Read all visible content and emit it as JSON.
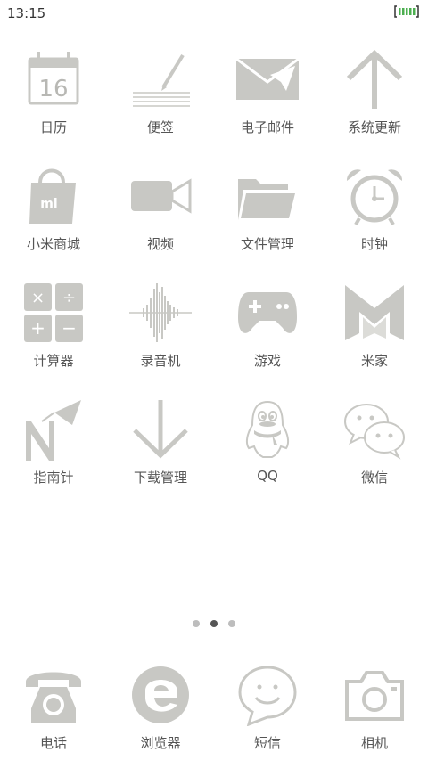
{
  "status": {
    "time": "13:15"
  },
  "apps": [
    {
      "label": "日历",
      "icon": "calendar-icon",
      "badge": "16"
    },
    {
      "label": "便签",
      "icon": "notes-icon"
    },
    {
      "label": "电子邮件",
      "icon": "email-icon"
    },
    {
      "label": "系统更新",
      "icon": "update-arrow-icon"
    },
    {
      "label": "小米商城",
      "icon": "mi-store-bag-icon",
      "badge": "mi"
    },
    {
      "label": "视频",
      "icon": "video-camera-icon"
    },
    {
      "label": "文件管理",
      "icon": "folder-icon"
    },
    {
      "label": "时钟",
      "icon": "alarm-clock-icon"
    },
    {
      "label": "计算器",
      "icon": "calculator-icon",
      "symbols": [
        "×",
        "÷",
        "+",
        "−"
      ]
    },
    {
      "label": "录音机",
      "icon": "sound-wave-icon"
    },
    {
      "label": "游戏",
      "icon": "gamepad-icon"
    },
    {
      "label": "米家",
      "icon": "mijia-m-icon"
    },
    {
      "label": "指南针",
      "icon": "compass-icon"
    },
    {
      "label": "下载管理",
      "icon": "download-arrow-icon"
    },
    {
      "label": "QQ",
      "icon": "qq-penguin-icon"
    },
    {
      "label": "微信",
      "icon": "wechat-icon"
    }
  ],
  "pager": {
    "count": 3,
    "active": 1
  },
  "dock": [
    {
      "label": "电话",
      "icon": "telephone-icon"
    },
    {
      "label": "浏览器",
      "icon": "browser-e-icon"
    },
    {
      "label": "短信",
      "icon": "smiley-message-icon"
    },
    {
      "label": "相机",
      "icon": "camera-icon"
    }
  ],
  "colors": {
    "icon": "#c8c8c4",
    "label": "#555555",
    "battery": "#4caf50"
  }
}
